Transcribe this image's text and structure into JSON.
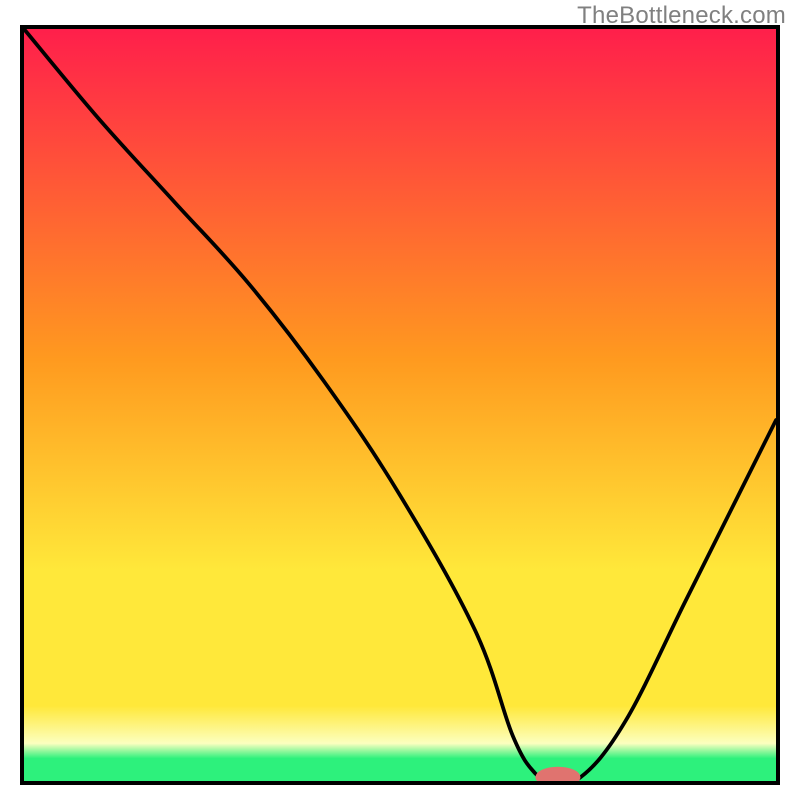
{
  "watermark": "TheBottleneck.com",
  "colors": {
    "gradient_top": "#ff1f4b",
    "gradient_mid": "#ff9a1f",
    "gradient_low": "#ffe83a",
    "gradient_pale": "#fcffbf",
    "gradient_green": "#2df17c",
    "curve": "#000000",
    "marker_fill": "#e0736f",
    "border": "#000000"
  },
  "chart_data": {
    "type": "line",
    "title": "",
    "xlabel": "",
    "ylabel": "",
    "xlim": [
      0,
      100
    ],
    "ylim": [
      0,
      100
    ],
    "grid": false,
    "legend": false,
    "series": [
      {
        "name": "bottleneck-curve",
        "x": [
          0,
          10,
          20,
          30,
          40,
          50,
          60,
          65,
          68,
          70,
          74,
          80,
          88,
          95,
          100
        ],
        "y": [
          100,
          88,
          77,
          66,
          53,
          38,
          20,
          6,
          1,
          0.5,
          0.5,
          8,
          24,
          38,
          48
        ]
      }
    ],
    "marker": {
      "name": "operating-point",
      "x": 71,
      "y": 0.5,
      "rx": 3,
      "ry": 1.4
    },
    "bands": [
      {
        "name": "red",
        "from_y": 56,
        "to_y": 100,
        "color": "#ff1f4b"
      },
      {
        "name": "orange",
        "from_y": 30,
        "to_y": 56,
        "color": "#ff9a1f"
      },
      {
        "name": "yellow",
        "from_y": 10,
        "to_y": 30,
        "color": "#ffe83a"
      },
      {
        "name": "paleyellow",
        "from_y": 4,
        "to_y": 10,
        "color": "#fcffbf"
      },
      {
        "name": "green",
        "from_y": 0,
        "to_y": 4,
        "color": "#2df17c"
      }
    ]
  }
}
